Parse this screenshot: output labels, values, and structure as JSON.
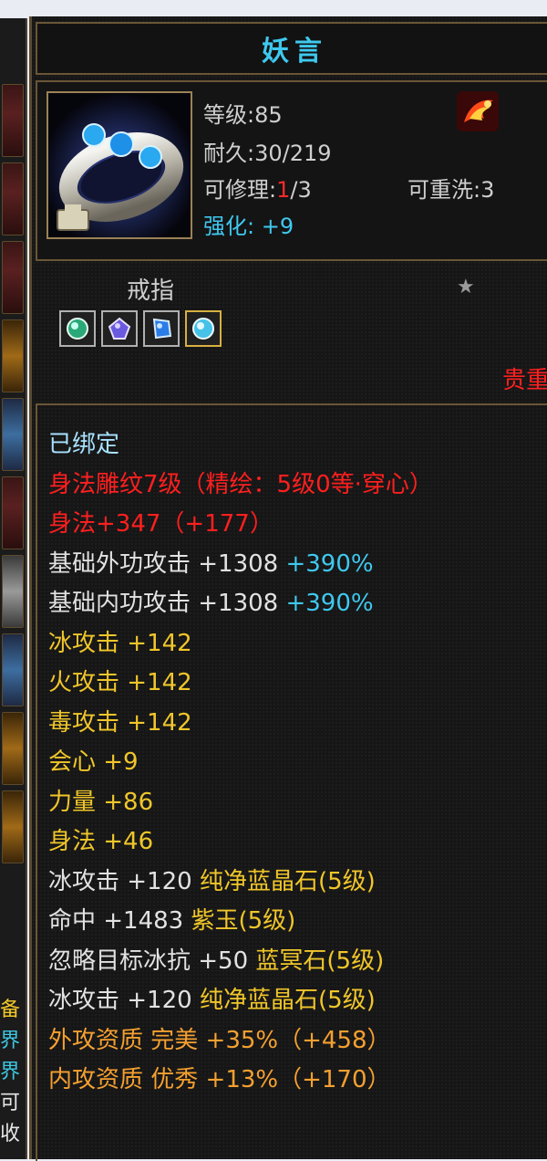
{
  "left_strip": {
    "chars": [
      "备",
      "界",
      "界",
      "可",
      "收"
    ]
  },
  "item": {
    "name": "妖言",
    "icon": "ring-icon",
    "level_line": "等级:85",
    "durability_line": "耐久:30/219",
    "repair_prefix": "可修理:",
    "repair_used": "1",
    "repair_total": "/3",
    "rewash_line": "可重洗:3",
    "enhance_line": "强化: +9",
    "type": "戒指",
    "rarity": "贵重"
  },
  "gems": [
    {
      "name": "gem-green-icon",
      "color": "#3ad0a0"
    },
    {
      "name": "gem-purple-icon",
      "color": "#7c6cf0"
    },
    {
      "name": "gem-blue-icon",
      "color": "#3a8cf0"
    },
    {
      "name": "gem-cyan-icon",
      "color": "#5ed6f0"
    }
  ],
  "attributes": [
    {
      "text": "已绑定",
      "color": "cyan"
    },
    {
      "text": "身法雕纹7级（精绘：5级0等·穿心）",
      "color": "red"
    },
    {
      "text": "身法+347（+177）",
      "color": "red"
    },
    {
      "text": "基础外功攻击 +1308",
      "extra": " +390%",
      "color": "white"
    },
    {
      "text": "基础内功攻击 +1308",
      "extra": " +390%",
      "color": "white"
    },
    {
      "text": "冰攻击 +142",
      "color": "yellow"
    },
    {
      "text": "火攻击 +142",
      "color": "yellow"
    },
    {
      "text": "毒攻击 +142",
      "color": "yellow"
    },
    {
      "text": "会心 +9",
      "color": "yellow"
    },
    {
      "text": "力量 +86",
      "color": "yellow"
    },
    {
      "text": "身法 +46",
      "color": "yellow"
    },
    {
      "text": "冰攻击 +120",
      "extra": " 纯净蓝晶石(5级)",
      "color": "white"
    },
    {
      "text": "命中 +1483",
      "extra": " 紫玉(5级)",
      "color": "white"
    },
    {
      "text": "忽略目标冰抗 +50",
      "extra": " 蓝冥石(5级)",
      "color": "white"
    },
    {
      "text": "冰攻击 +120",
      "extra": " 纯净蓝晶石(5级)",
      "color": "white"
    },
    {
      "text": "外攻资质  完美 +35%（+458）",
      "color": "orange"
    },
    {
      "text": "内攻资质  优秀 +13%（+170）",
      "color": "orange"
    }
  ]
}
